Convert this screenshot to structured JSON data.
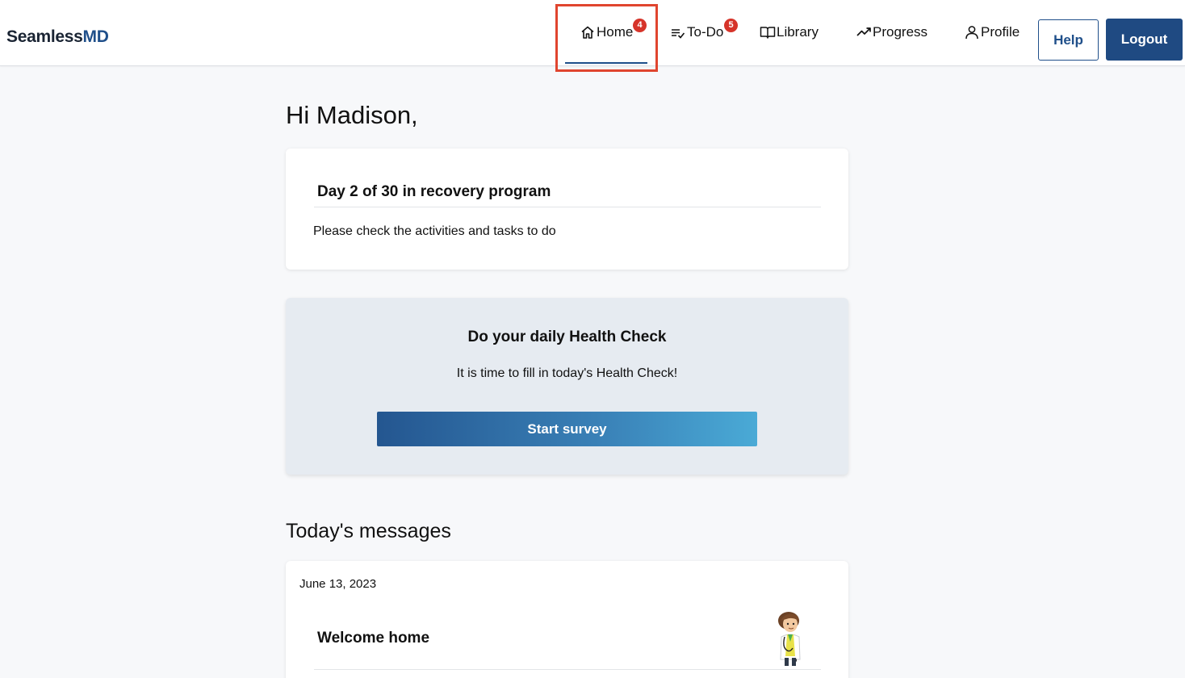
{
  "header": {
    "logo_part1": "Seamless",
    "logo_part2": "MD",
    "nav": [
      {
        "label": "Home",
        "icon": "home-icon",
        "badge": "4",
        "active": true
      },
      {
        "label": "To-Do",
        "icon": "todo-list-icon",
        "badge": "5"
      },
      {
        "label": "Library",
        "icon": "book-icon"
      },
      {
        "label": "Progress",
        "icon": "trend-up-icon"
      },
      {
        "label": "Profile",
        "icon": "user-icon"
      }
    ],
    "help_label": "Help",
    "logout_label": "Logout"
  },
  "main": {
    "greeting": "Hi Madison,",
    "recovery": {
      "title": "Day 2 of 30 in recovery program",
      "body": "Please check the activities and tasks to do"
    },
    "health_check": {
      "title": "Do your daily Health Check",
      "body": "It is time to fill in today's Health Check!",
      "button_label": "Start survey"
    },
    "messages": {
      "section_title": "Today's messages",
      "items": [
        {
          "date": "June 13, 2023",
          "title": "Welcome home",
          "avatar": "doctor-avatar-icon"
        }
      ]
    }
  },
  "colors": {
    "brand_dark": "#1a2433",
    "brand_blue": "#1f4f8a",
    "badge_red": "#d6342a",
    "highlight": "#e0452f"
  }
}
